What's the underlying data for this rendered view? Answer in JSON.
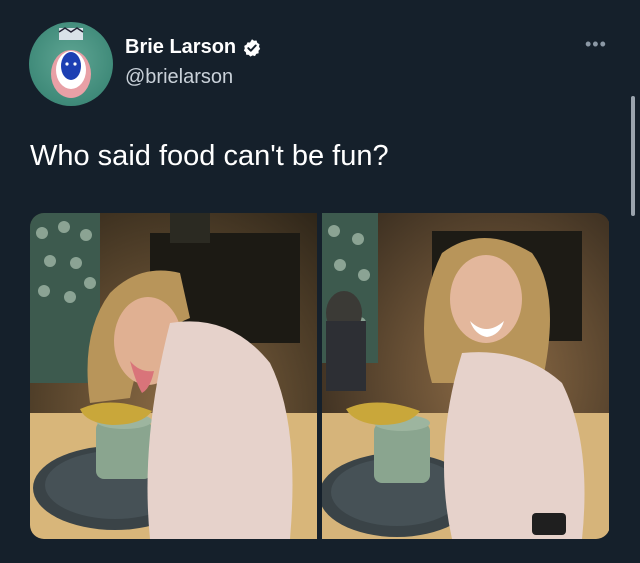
{
  "user": {
    "display_name": "Brie Larson",
    "handle": "@brielarson",
    "verified": true
  },
  "tweet": {
    "text": "Who said food can't be fun?"
  },
  "menu": {
    "more_label": "•••"
  },
  "media": [
    {
      "description": "woman licking leaf garnish of a plated dessert"
    },
    {
      "description": "woman laughing over a plated dessert"
    }
  ],
  "colors": {
    "background": "#15202b",
    "text_primary": "#ffffff",
    "text_secondary": "#c9d1d9",
    "verified_badge": "#ffffff"
  }
}
